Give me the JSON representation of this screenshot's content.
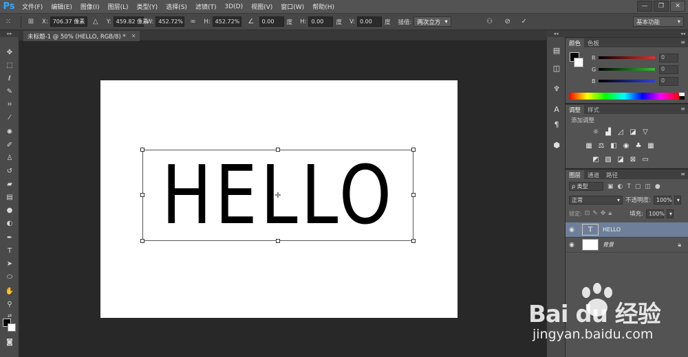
{
  "app": {
    "logo": "Ps"
  },
  "menu": [
    "文件(F)",
    "编辑(E)",
    "图像(I)",
    "图层(L)",
    "类型(Y)",
    "选择(S)",
    "滤镜(T)",
    "3D(D)",
    "视图(V)",
    "窗口(W)",
    "帮助(H)"
  ],
  "window_controls": {
    "minimize": "—",
    "restore": "❐",
    "close": "✕"
  },
  "options": {
    "x_label": "X:",
    "x_value": "706.37 像素",
    "y_label": "Y:",
    "y_value": "459.82 像素",
    "w_label": "W:",
    "w_value": "452.72%",
    "h_label": "H:",
    "h_value": "452.72%",
    "angle_value": "0.00",
    "angle_unit": "度",
    "hskew_label": "H:",
    "hskew_value": "0.00",
    "hskew_unit": "度",
    "vskew_label": "V:",
    "vskew_value": "0.00",
    "vskew_unit": "度",
    "interp_label": "插值:",
    "interp_value": "两次立方",
    "workspace": "基本功能"
  },
  "document": {
    "tab_title": "未标题-1 @ 50% (HELLO, RGB/8) *",
    "text": "HELLO"
  },
  "color_panel": {
    "tabs": [
      "颜色",
      "色板"
    ],
    "sliders": [
      {
        "letter": "R",
        "value": "0",
        "color": "#e03030"
      },
      {
        "letter": "G",
        "value": "0",
        "color": "#30c030"
      },
      {
        "letter": "B",
        "value": "0",
        "color": "#3040e0"
      }
    ]
  },
  "adjust_panel": {
    "tabs": [
      "调整",
      "样式"
    ],
    "title": "添加调整"
  },
  "layers_panel": {
    "tabs": [
      "图层",
      "通道",
      "路径"
    ],
    "filter_kind": "ρ 类型",
    "blend_mode": "正常",
    "opacity_label": "不透明度:",
    "opacity_value": "100%",
    "lock_label": "锁定:",
    "fill_label": "填充:",
    "fill_value": "100%",
    "layers": [
      {
        "name": "HELLO",
        "thumb": "T",
        "active": true
      },
      {
        "name": "背景",
        "thumb": "",
        "active": false
      }
    ]
  },
  "watermark": {
    "brand": "Bai du 经验",
    "site": "jingyan.baidu.com"
  }
}
